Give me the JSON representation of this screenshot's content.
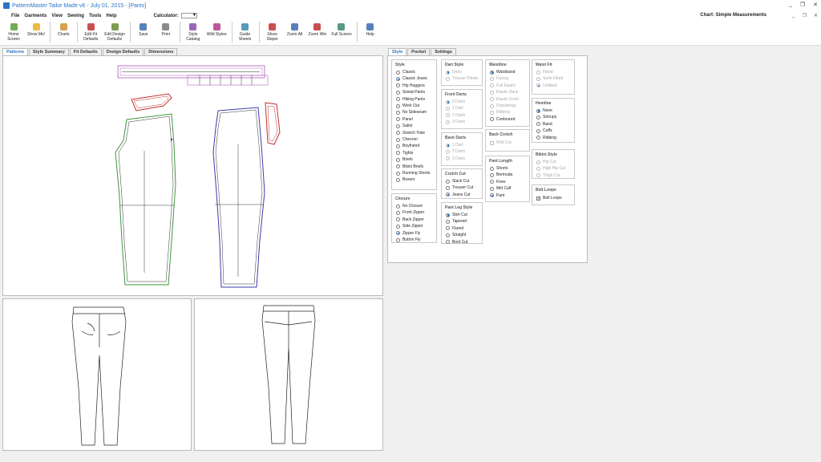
{
  "window": {
    "title": "PatternMaster Tailor Made v6 - July 01, 2015 - [Pants]",
    "minimize": "_",
    "restore": "❐",
    "close": "✕"
  },
  "menu": {
    "items": [
      "File",
      "Garments",
      "View",
      "Sewing",
      "Tools",
      "Help"
    ],
    "calculator_label": "Calculator:",
    "chart_label": "Chart: Simple Measurements"
  },
  "toolbar": [
    {
      "label": "Home\nScreen",
      "icon": "home-icon",
      "color": "#5a9e3a"
    },
    {
      "label": "Show Me!",
      "icon": "lightbulb-icon",
      "color": "#e8b020"
    },
    {
      "label": "Charts",
      "icon": "charts-icon",
      "color": "#d09030"
    },
    {
      "label": "Edit Fit\nDefaults",
      "icon": "edit-fit-icon",
      "color": "#c03030"
    },
    {
      "label": "Edit Design\nDefaults",
      "icon": "edit-design-icon",
      "color": "#6a8a3a"
    },
    {
      "label": "Save",
      "icon": "save-icon",
      "color": "#3a6ab0"
    },
    {
      "label": "Print",
      "icon": "print-icon",
      "color": "#777777"
    },
    {
      "label": "Style\nCatalog",
      "icon": "style-catalog-icon",
      "color": "#8a4ab0"
    },
    {
      "label": "Wild Styles",
      "icon": "wild-styles-icon",
      "color": "#b03a8a"
    },
    {
      "label": "Guide\nSheets",
      "icon": "guide-sheets-icon",
      "color": "#3a8ab0"
    },
    {
      "label": "Show\nSloper",
      "icon": "show-sloper-icon",
      "color": "#c03030"
    },
    {
      "label": "Zoom All",
      "icon": "zoom-all-icon",
      "color": "#3a6ab0"
    },
    {
      "label": "Zoom Win",
      "icon": "zoom-win-icon",
      "color": "#c03030"
    },
    {
      "label": "Full Screen",
      "icon": "full-screen-icon",
      "color": "#3a8a6a"
    },
    {
      "label": "Help",
      "icon": "help-icon",
      "color": "#3a6ab0"
    }
  ],
  "left_tabs": [
    "Patterns",
    "Style Summary",
    "Fit Defaults",
    "Design Defaults",
    "Dimensions"
  ],
  "right_tabs": [
    "Style",
    "Pocket",
    "Settings"
  ],
  "colors": {
    "accent": "#2a74c8",
    "front_piece": "#3a9a3a",
    "back_piece": "#3a3ab0",
    "pocket": "#c03030",
    "waistband": "#a040b0"
  },
  "style_groups": {
    "style": {
      "title": "Style",
      "options": [
        "Classic",
        "Classic Jeans",
        "Hip Huggers",
        "Sweat Pants",
        "Hiking Pants",
        "Work Out",
        "No Sideseam",
        "Panel",
        "Sailor",
        "Stretch Yoke",
        "Chevron",
        "Boyfriend",
        "Tights",
        "Briefs",
        "Bikini Briefs",
        "Running Shorts",
        "Boxers"
      ],
      "selected": "Classic Jeans"
    },
    "closure": {
      "title": "Closure",
      "options": [
        "No Closure",
        "Front Zipper",
        "Back Zipper",
        "Side Zipper",
        "Zipper Fly",
        "Button Fly"
      ],
      "selected": "Zipper Fly"
    },
    "dart_style": {
      "title": "Dart Style",
      "options": [
        "Darts",
        "Trouser Pleats"
      ],
      "selected": "Darts",
      "disabled": true
    },
    "front_darts": {
      "title": "Front Darts",
      "options": [
        "0 Darts",
        "1 Dart",
        "2 Darts",
        "3 Darts"
      ],
      "selected": "0 Darts",
      "disabled": true
    },
    "back_darts": {
      "title": "Back Darts",
      "options": [
        "1 Dart",
        "2 Darts",
        "3 Darts"
      ],
      "selected": "1 Dart",
      "disabled": true
    },
    "crotch_cut": {
      "title": "Crotch Cut",
      "options": [
        "Slack Cut",
        "Trouser Cut",
        "Jeans Cut"
      ],
      "selected": "Jeans Cut"
    },
    "pant_leg_style": {
      "title": "Pant Leg Style",
      "options": [
        "Slim Cut",
        "Tapered",
        "Flared",
        "Straight",
        "Boot Cut"
      ],
      "selected": "Slim Cut"
    },
    "waistline": {
      "title": "Waistline",
      "options": [
        "Waistband",
        "Facing",
        "Full Elastic",
        "Elastic Back",
        "Elastic Front",
        "Drawstring",
        "Ribbing",
        "Contoured"
      ],
      "selected": "Waistband",
      "disabled_options": [
        "Facing",
        "Full Elastic",
        "Elastic Back",
        "Elastic Front",
        "Drawstring",
        "Ribbing"
      ]
    },
    "back_crotch": {
      "title": "Back Crotch",
      "checkbox": "Wild Cut",
      "checked": false,
      "disabled": true
    },
    "pant_length": {
      "title": "Pant Length",
      "options": [
        "Shorts",
        "Bermuda",
        "Knee",
        "Mid Calf",
        "Pant"
      ],
      "selected": "Pant"
    },
    "waist_fit": {
      "title": "Waist Fit",
      "options": [
        "Fitted",
        "Semi Fitted",
        "Unfitted"
      ],
      "selected": "Unfitted",
      "disabled": true
    },
    "hemline": {
      "title": "Hemline",
      "options": [
        "None",
        "Stirrups",
        "Band",
        "Cuffs",
        "Ribbing"
      ],
      "selected": "None"
    },
    "bikini_style": {
      "title": "Bikini Style",
      "options": [
        "Hip Cut",
        "High Hip Cut",
        "Thigh Cut"
      ],
      "selected": "",
      "disabled": true
    },
    "belt_loops": {
      "title": "Belt Loops",
      "checkbox": "Belt Loops",
      "checked": true
    }
  }
}
